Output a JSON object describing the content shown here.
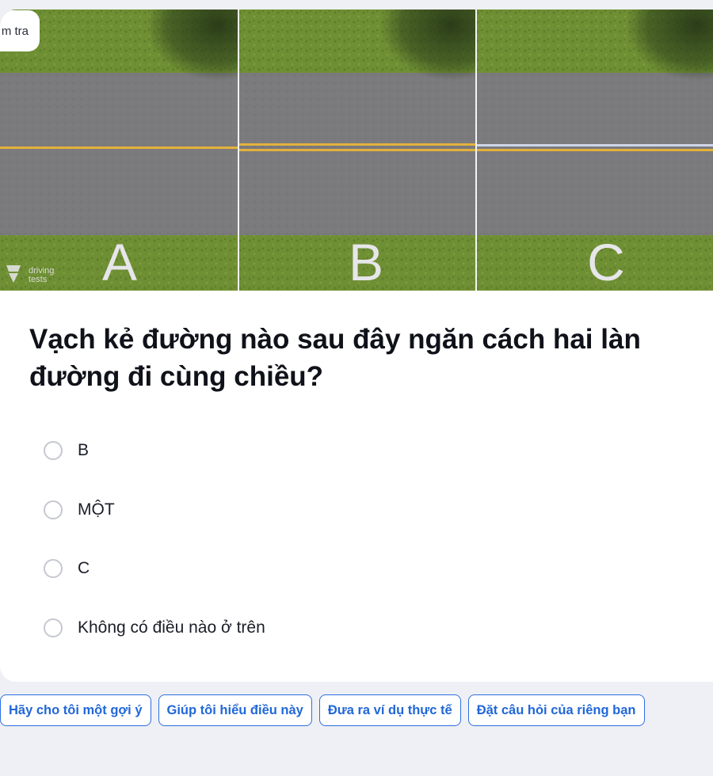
{
  "header": {
    "badge_label": "m tra"
  },
  "illustration": {
    "panels": [
      "A",
      "B",
      "C"
    ],
    "watermark": "driving tests"
  },
  "question": {
    "text": "Vạch kẻ đường nào sau đây ngăn cách hai làn đường đi cùng chiều?"
  },
  "options": [
    {
      "label": "B"
    },
    {
      "label": "MỘT"
    },
    {
      "label": "C"
    },
    {
      "label": "Không có điều nào ở trên"
    }
  ],
  "chips": [
    {
      "label": "Hãy cho tôi một gợi ý"
    },
    {
      "label": "Giúp tôi hiểu điều này"
    },
    {
      "label": "Đưa ra ví dụ thực tế"
    },
    {
      "label": "Đặt câu hỏi của riêng bạn"
    }
  ],
  "colors": {
    "accent": "#2167d8",
    "background": "#eff0f5",
    "road": "#7a7a7c",
    "grass": "#6f8f34",
    "yellow_line": "#e3b23c"
  }
}
